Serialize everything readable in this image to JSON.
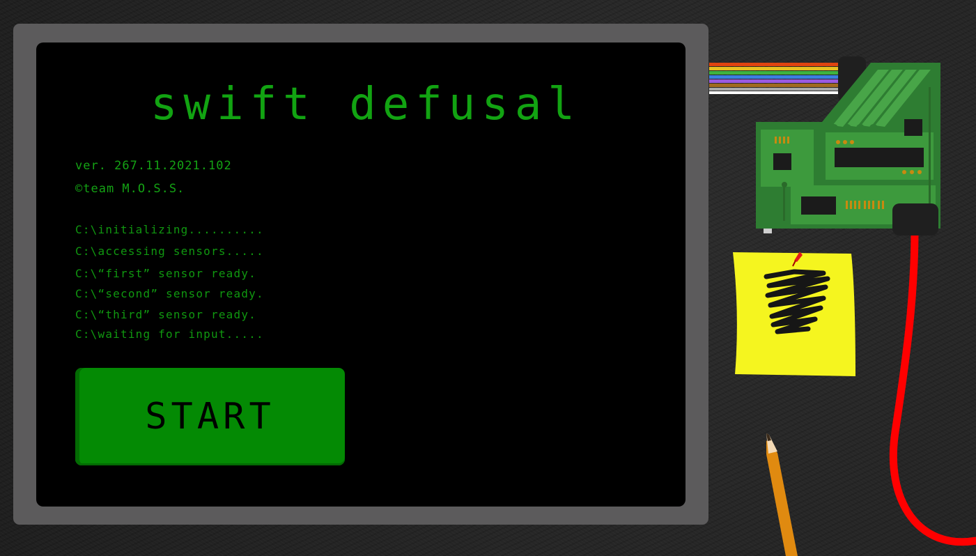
{
  "game": {
    "title": "swift defusal",
    "version": "ver. 267.11.2021.102",
    "credits": "©team M.O.S.S."
  },
  "console": {
    "lines": [
      "C:\\initializing..........",
      "C:\\accessing sensors.....",
      "C:\\“first” sensor ready.",
      "C:\\“second” sensor ready.",
      "C:\\“third” sensor ready.",
      "C:\\waiting for input....."
    ]
  },
  "buttons": {
    "start_label": "START"
  },
  "colors": {
    "terminal_green": "#12a312",
    "button_green": "#048a04",
    "bezel_grey": "#5c5b5c",
    "desk": "#262626",
    "sticky_yellow": "#f5f51f",
    "cable_red": "#ff0000",
    "pcb_green": "#3a8a3a"
  },
  "icons": {
    "circuit_board": "circuit-board-icon",
    "ribbon_cable": "ribbon-cable-icon",
    "red_cable": "red-cable-icon",
    "sticky_note": "sticky-note-icon",
    "pushpin": "pushpin-icon",
    "pencil": "pencil-icon"
  }
}
